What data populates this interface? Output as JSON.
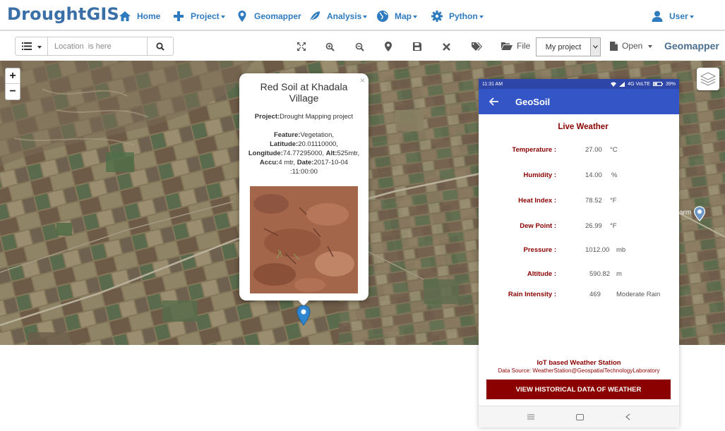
{
  "brand": "DroughtGIS",
  "nav": {
    "home": "Home",
    "project": "Project",
    "geomapper": "Geomapper",
    "analysis": "Analysis",
    "map": "Map",
    "python": "Python",
    "user": "User"
  },
  "toolbar": {
    "location_placeholder": "Location  is here",
    "file_label": "File",
    "project_select": "My project",
    "open_label": "Open",
    "geomapper_label": "Geomapper"
  },
  "map_controls": {
    "zoom_in": "+",
    "zoom_out": "−"
  },
  "popup": {
    "close": "×",
    "title": "Red Soil at Khadala Village",
    "project_label": "Project:",
    "project_value": "Drought Mapping project",
    "feature_label": "Feature:",
    "feature_value": "Vegetation,",
    "latitude_label": "Latitude:",
    "latitude_value": "20.01110000,",
    "longitude_label": "Longitude:",
    "longitude_value": "74.77295000,",
    "alt_label": "Alt:",
    "alt_value": "525mtr,",
    "accu_label": "Accu:",
    "accu_value": "4 mtr,",
    "date_label": "Date:",
    "date_value": "2017-10-04",
    "time_value": ":11:00:00"
  },
  "map_label": "arm",
  "phone": {
    "status_time": "11:31 AM",
    "status_right": "4G VoLTE",
    "battery": "39%",
    "app_title": "GeoSoil",
    "live_weather": "Live Weather",
    "rows": [
      {
        "label": "Temperature :",
        "value": "27.00",
        "unit": "°C"
      },
      {
        "label": "Humidity :",
        "value": "14.00",
        "unit": "%"
      },
      {
        "label": "Heat Index :",
        "value": "78.52",
        "unit": "°F"
      },
      {
        "label": "Dew Point :",
        "value": "26.99",
        "unit": "°F"
      },
      {
        "label": "Pressure :",
        "value": "1012.00",
        "unit": "mb"
      },
      {
        "label": "Altitude :",
        "value": "590.82",
        "unit": "m"
      },
      {
        "label": "Rain Intensity :",
        "value": "469",
        "unit": "Moderate Rain"
      }
    ],
    "iot_title": "IoT based Weather Station",
    "data_source": "Data Source: WeatherStation@GeospatialTechnologyLaboratory",
    "history_button": "VIEW HISTORICAL DATA OF WEATHER"
  },
  "colors": {
    "brand": "#3b6fa8",
    "nav_link": "#2f7bbf",
    "app_bar": "#3455c5",
    "accent_dark_red": "#8b0000"
  }
}
